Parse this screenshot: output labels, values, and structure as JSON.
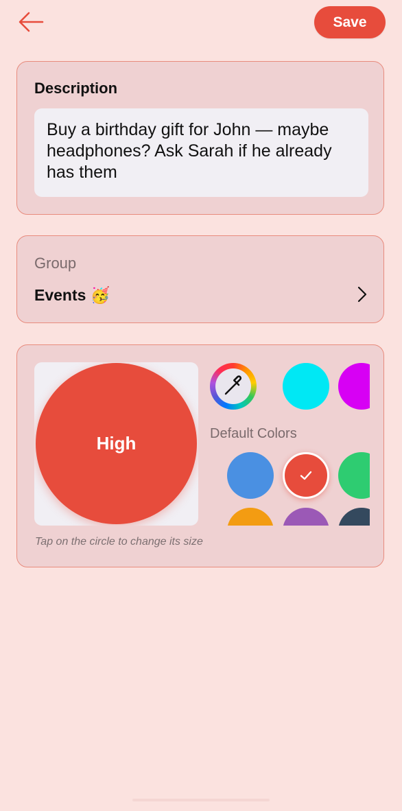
{
  "colors": {
    "accent": "#e74c3c",
    "background": "#fbe2df",
    "card": "#efd1d2",
    "card_border": "#e88b7d",
    "input_bg": "#f1eff4"
  },
  "header": {
    "back_icon": "arrow-left-icon",
    "save_label": "Save"
  },
  "description": {
    "title": "Description",
    "value": "Buy a birthday gift for John — maybe headphones? Ask Sarah if he already has them"
  },
  "group": {
    "label": "Group",
    "value": "Events 🥳",
    "chevron_icon": "chevron-right-icon"
  },
  "priority": {
    "label": "High",
    "color": "#e74c3c",
    "hint": "Tap on the circle to change its size"
  },
  "color_picker": {
    "picker_icon": "eyedropper-icon",
    "custom_colors": [
      "#00e8f4",
      "#d700f4"
    ],
    "default_label": "Default Colors",
    "default_colors": [
      "#4a90e2",
      "#e74c3c",
      "#2ecc71",
      "#f39c12",
      "#9b59b6",
      "#34495e"
    ],
    "selected": "#e74c3c",
    "check_icon": "checkmark-icon"
  }
}
